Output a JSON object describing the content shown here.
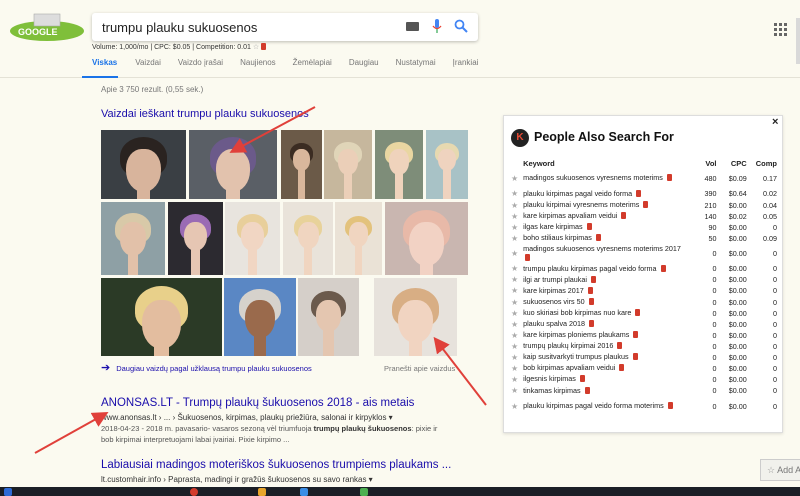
{
  "search": {
    "query": "trumpu plauku sukuosenos",
    "keyword_info": "Volume: 1,000/mo | CPC: $0.05 | Competition: 0.01",
    "logo_text": "GOOGLE"
  },
  "tabs": [
    "Viskas",
    "Vaizdai",
    "Vaizdo įrašai",
    "Naujienos",
    "Žemėlapiai",
    "Daugiau",
    "Nustatymai",
    "Įrankiai"
  ],
  "result_count": "Apie 3 750 rezult. (0,55 sek.)",
  "images": {
    "heading": "Vaizdai ieškant trumpu plauku sukuosenos",
    "more": "Daugiau vaizdų pagal užklausą trumpu plauku sukuosenos",
    "report": "Pranešti apie vaizdus"
  },
  "results": [
    {
      "title": "ANONSAS.LT - Trumpų plaukų šukuosenos 2018 - ais metais",
      "url": "www.anonsas.lt › ... › Šukuosenos, kirpimas, plaukų priežiūra, salonai ir kirpyklos ▾",
      "snippet1_pre": "2018-04-23 - 2018 m. pavasario- vasaros sezoną vėl triumfuoja ",
      "snippet1_bold": "trumpų plaukų šukuosenos",
      "snippet1_post": ": pixie ir",
      "snippet2": "bob kirpimai interpretuojami labai įvairiai. Pixie kirpimo ..."
    },
    {
      "title": "Labiausiai madingos moteriškos šukuosenos trumpiems plaukams ...",
      "url": "lt.customhair.info › Paprasta, madingi ir gražūs šukuosenos su savo rankas ▾"
    }
  ],
  "panel": {
    "title": "People Also Search For",
    "close": "×",
    "headers": {
      "keyword": "Keyword",
      "vol": "Vol",
      "cpc": "CPC",
      "comp": "Comp"
    },
    "rows": [
      {
        "keyword": "madingos sukuosenos vyresnems moterims",
        "vol": "480",
        "cpc": "$0.09",
        "comp": "0.17",
        "wrap": true
      },
      {
        "keyword": "plauku kirpimas pagal veido forma",
        "vol": "390",
        "cpc": "$0.64",
        "comp": "0.02"
      },
      {
        "keyword": "plauku kirpimai vyresnems moterims",
        "vol": "210",
        "cpc": "$0.00",
        "comp": "0.04"
      },
      {
        "keyword": "kare kirpimas apvaliam veidui",
        "vol": "140",
        "cpc": "$0.02",
        "comp": "0.05"
      },
      {
        "keyword": "ilgas kare kirpimas",
        "vol": "90",
        "cpc": "$0.00",
        "comp": "0"
      },
      {
        "keyword": "boho stiliaus kirpimas",
        "vol": "50",
        "cpc": "$0.00",
        "comp": "0.09"
      },
      {
        "keyword": "madingos sukuosenos vyresnems moterims 2017",
        "vol": "0",
        "cpc": "$0.00",
        "comp": "0",
        "wrap": true
      },
      {
        "keyword": "trumpu plauku kirpimas pagal veido forma",
        "vol": "0",
        "cpc": "$0.00",
        "comp": "0"
      },
      {
        "keyword": "ilgi ar trumpi plaukai",
        "vol": "0",
        "cpc": "$0.00",
        "comp": "0"
      },
      {
        "keyword": "kare kirpimas 2017",
        "vol": "0",
        "cpc": "$0.00",
        "comp": "0"
      },
      {
        "keyword": "sukuosenos virs 50",
        "vol": "0",
        "cpc": "$0.00",
        "comp": "0"
      },
      {
        "keyword": "kuo skiriasi bob kirpimas nuo kare",
        "vol": "0",
        "cpc": "$0.00",
        "comp": "0"
      },
      {
        "keyword": "plauku spalva 2018",
        "vol": "0",
        "cpc": "$0.00",
        "comp": "0"
      },
      {
        "keyword": "kare kirpimas ploniems plaukams",
        "vol": "0",
        "cpc": "$0.00",
        "comp": "0"
      },
      {
        "keyword": "trumpų plaukų kirpimai 2016",
        "vol": "0",
        "cpc": "$0.00",
        "comp": "0"
      },
      {
        "keyword": "kaip susitvarkyti trumpus plaukus",
        "vol": "0",
        "cpc": "$0.00",
        "comp": "0"
      },
      {
        "keyword": "bob kirpimas apvaliam veidui",
        "vol": "0",
        "cpc": "$0.00",
        "comp": "0"
      },
      {
        "keyword": "ilgesnis kirpimas",
        "vol": "0",
        "cpc": "$0.00",
        "comp": "0"
      },
      {
        "keyword": "tinkamas kirpimas",
        "vol": "0",
        "cpc": "$0.00",
        "comp": "0"
      },
      {
        "keyword": "plauku kirpimas pagal veido forma moterims",
        "vol": "0",
        "cpc": "$0.00",
        "comp": "0",
        "wrap": true
      }
    ]
  },
  "add_button": "Add A",
  "colors": {
    "link": "#1a0dab",
    "accent": "#1a73e8",
    "annotation": "#e0403a"
  }
}
